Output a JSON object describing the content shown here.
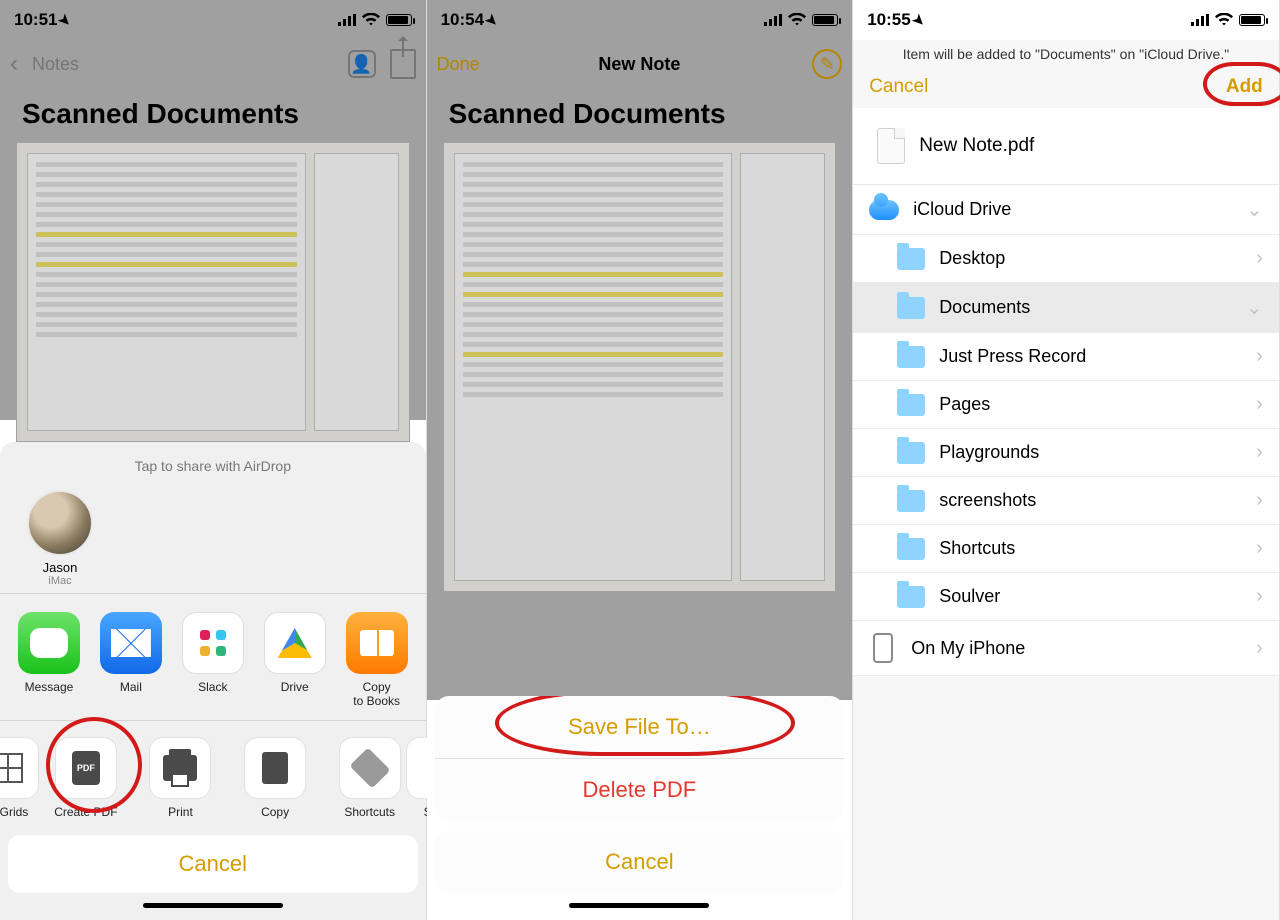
{
  "panel1": {
    "time": "10:51",
    "back_label": "Notes",
    "note_title": "Scanned Documents",
    "airdrop_hint": "Tap to share with AirDrop",
    "contact": {
      "name": "Jason",
      "device": "iMac"
    },
    "apps": {
      "message": "Message",
      "mail": "Mail",
      "slack": "Slack",
      "drive": "Drive",
      "copy_books": "Copy\nto Books"
    },
    "actions": {
      "grids": "& Grids",
      "create_pdf": "Create PDF",
      "print": "Print",
      "copy": "Copy",
      "shortcuts": "Shortcuts",
      "save": "Save"
    },
    "cancel": "Cancel"
  },
  "panel2": {
    "time": "10:54",
    "done": "Done",
    "title": "New Note",
    "note_title": "Scanned Documents",
    "save_to": "Save File To…",
    "delete_pdf": "Delete PDF",
    "cancel": "Cancel"
  },
  "panel3": {
    "time": "10:55",
    "info": "Item will be added to \"Documents\" on \"iCloud Drive.\"",
    "cancel": "Cancel",
    "add": "Add",
    "file_name": "New Note.pdf",
    "locations": {
      "icloud": "iCloud Drive",
      "folders": [
        "Desktop",
        "Documents",
        "Just Press Record",
        "Pages",
        "Playgrounds",
        "screenshots",
        "Shortcuts",
        "Soulver"
      ],
      "selected": "Documents",
      "on_device": "On My iPhone"
    }
  }
}
